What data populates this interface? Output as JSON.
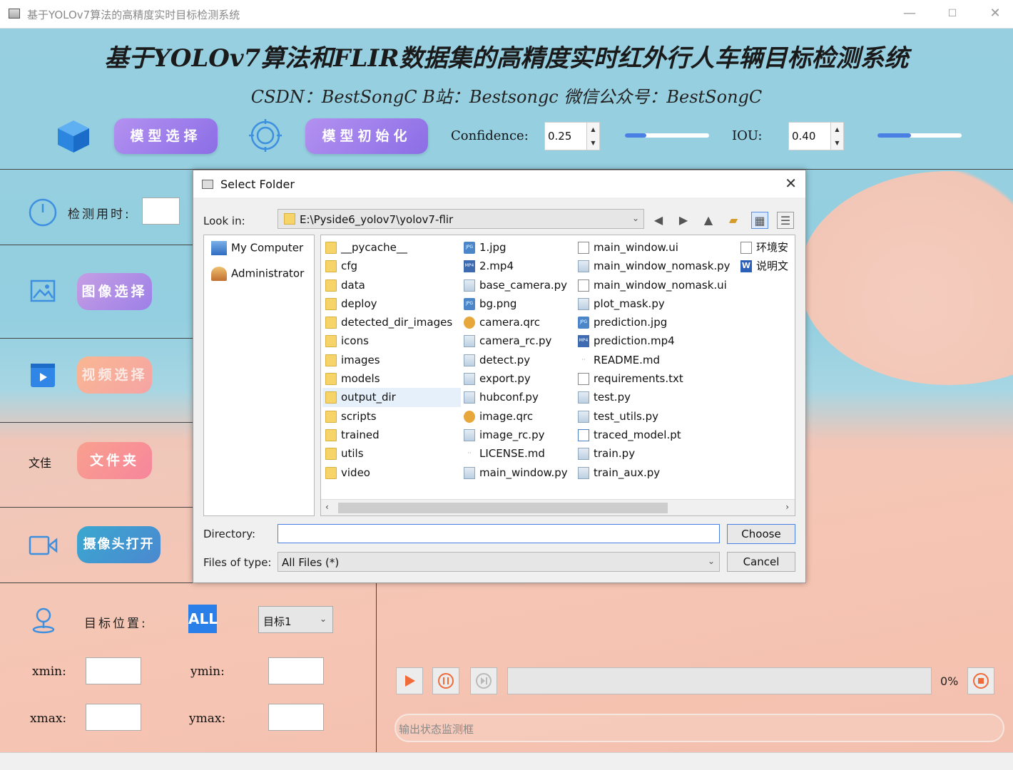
{
  "window": {
    "title": "基于YOLOv7算法的高精度实时目标检测系统"
  },
  "header": {
    "title": "基于YOLOv7算法和FLIR数据集的高精度实时红外行人车辆目标检测系统",
    "subtitle": "CSDN：BestSongC   B站：Bestsongc   微信公众号：BestSongC"
  },
  "toolbar": {
    "model_select": "模型选择",
    "model_init": "模型初始化",
    "confidence_label": "Confidence:",
    "confidence_value": "0.25",
    "confidence_level": 0.25,
    "iou_label": "IOU:",
    "iou_value": "0.40",
    "iou_level": 0.4
  },
  "left": {
    "time_label": "检测用时:",
    "image_btn": "图像选择",
    "video_btn": "视频选择",
    "file_label": "文佳",
    "file_btn": "文件夹",
    "camera_btn": "摄像头打开",
    "target_label": "目标位置:",
    "all_label": "ALL",
    "target_select": "目标1",
    "xmin": "xmin:",
    "ymin": "ymin:",
    "xmax": "xmax:",
    "ymax": "ymax:"
  },
  "player": {
    "percent": "0%",
    "status_placeholder": "输出状态监测框"
  },
  "dialog": {
    "title": "Select Folder",
    "look_in_label": "Look in:",
    "look_in_path": "E:\\Pyside6_yolov7\\yolov7-flir",
    "places": [
      {
        "label": "My Computer"
      },
      {
        "label": "Administrator"
      }
    ],
    "columns": [
      [
        {
          "name": "__pycache__",
          "icon": "folder"
        },
        {
          "name": "cfg",
          "icon": "folder"
        },
        {
          "name": "data",
          "icon": "folder"
        },
        {
          "name": "deploy",
          "icon": "folder"
        },
        {
          "name": "detected_dir_images",
          "icon": "folder"
        },
        {
          "name": "icons",
          "icon": "folder"
        },
        {
          "name": "images",
          "icon": "folder"
        },
        {
          "name": "models",
          "icon": "folder"
        },
        {
          "name": "output_dir",
          "icon": "folder",
          "selected": true
        },
        {
          "name": "scripts",
          "icon": "folder"
        },
        {
          "name": "trained",
          "icon": "folder"
        },
        {
          "name": "utils",
          "icon": "folder"
        },
        {
          "name": "video",
          "icon": "folder"
        }
      ],
      [
        {
          "name": "1.jpg",
          "icon": "img"
        },
        {
          "name": "2.mp4",
          "icon": "mp4"
        },
        {
          "name": "base_camera.py",
          "icon": "py"
        },
        {
          "name": "bg.png",
          "icon": "img"
        },
        {
          "name": "camera.qrc",
          "icon": "qrc"
        },
        {
          "name": "camera_rc.py",
          "icon": "py"
        },
        {
          "name": "detect.py",
          "icon": "py"
        },
        {
          "name": "export.py",
          "icon": "py"
        },
        {
          "name": "hubconf.py",
          "icon": "py"
        },
        {
          "name": "image.qrc",
          "icon": "qrc"
        },
        {
          "name": "image_rc.py",
          "icon": "py"
        },
        {
          "name": "LICENSE.md",
          "icon": "md"
        },
        {
          "name": "main_window.py",
          "icon": "py"
        }
      ],
      [
        {
          "name": "main_window.ui",
          "icon": "doc"
        },
        {
          "name": "main_window_nomask.py",
          "icon": "py"
        },
        {
          "name": "main_window_nomask.ui",
          "icon": "doc"
        },
        {
          "name": "plot_mask.py",
          "icon": "py"
        },
        {
          "name": "prediction.jpg",
          "icon": "img"
        },
        {
          "name": "prediction.mp4",
          "icon": "mp4"
        },
        {
          "name": "README.md",
          "icon": "md"
        },
        {
          "name": "requirements.txt",
          "icon": "doc"
        },
        {
          "name": "test.py",
          "icon": "py"
        },
        {
          "name": "test_utils.py",
          "icon": "py"
        },
        {
          "name": "traced_model.pt",
          "icon": "pt"
        },
        {
          "name": "train.py",
          "icon": "py"
        },
        {
          "name": "train_aux.py",
          "icon": "py"
        }
      ],
      [
        {
          "name": "环境安",
          "icon": "doc"
        },
        {
          "name": "说明文",
          "icon": "word"
        }
      ]
    ],
    "directory_label": "Directory:",
    "directory_value": "",
    "files_type_label": "Files of type:",
    "files_type_value": "All Files (*)",
    "choose": "Choose",
    "cancel": "Cancel"
  },
  "colors": {
    "accent": "#4a7fe4",
    "sky": "#97cfe0",
    "sand": "#f3c0b0"
  }
}
